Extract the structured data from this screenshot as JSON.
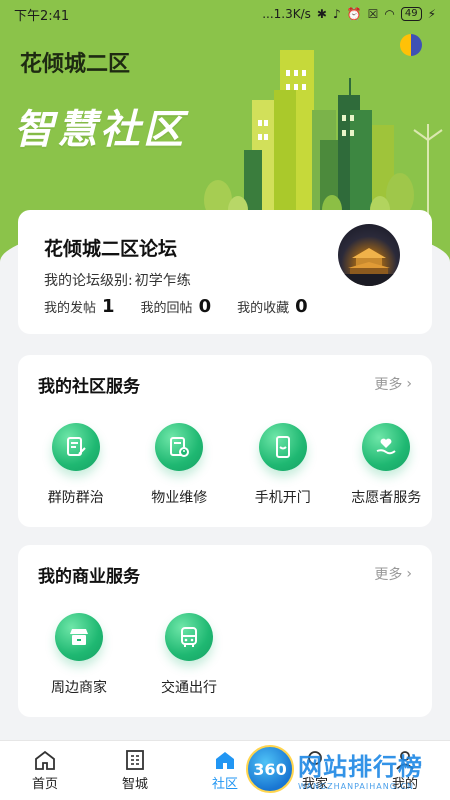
{
  "status_bar": {
    "time": "下午2:41",
    "net_speed": "...1.3K/s",
    "battery": "49"
  },
  "header": {
    "community_name": "花倾城二区",
    "slogan": "智慧社区"
  },
  "forum": {
    "title": "花倾城二区论坛",
    "level_label": "我的论坛级别:",
    "level_value": "初学乍练",
    "stats": [
      {
        "label": "我的发帖",
        "value": "1"
      },
      {
        "label": "我的回帖",
        "value": "0"
      },
      {
        "label": "我的收藏",
        "value": "0"
      }
    ]
  },
  "community_services": {
    "title": "我的社区服务",
    "more": "更多",
    "items": [
      {
        "label": "群防群治",
        "icon": "document-pen-icon"
      },
      {
        "label": "物业维修",
        "icon": "clipboard-clock-icon"
      },
      {
        "label": "手机开门",
        "icon": "phone-smile-icon"
      },
      {
        "label": "志愿者服务",
        "icon": "heart-hand-icon"
      }
    ]
  },
  "commerce_services": {
    "title": "我的商业服务",
    "more": "更多",
    "items": [
      {
        "label": "周边商家",
        "icon": "storefront-icon"
      },
      {
        "label": "交通出行",
        "icon": "bus-icon"
      }
    ]
  },
  "bottom_nav": {
    "items": [
      {
        "label": "首页",
        "icon": "home-outline-icon",
        "active": false
      },
      {
        "label": "智城",
        "icon": "building-icon",
        "active": false
      },
      {
        "label": "社区",
        "icon": "home-filled-icon",
        "active": true
      },
      {
        "label": "我家",
        "icon": "family-icon",
        "active": false
      },
      {
        "label": "我的",
        "icon": "user-icon",
        "active": false
      }
    ]
  },
  "watermark": {
    "badge": "360",
    "text": "网站排行榜",
    "sub": "WANGZHANPAIHANG.CN"
  },
  "colors": {
    "hero_green": "#8bc34a",
    "service_green": "#1fb872",
    "active_blue": "#2196f3"
  }
}
